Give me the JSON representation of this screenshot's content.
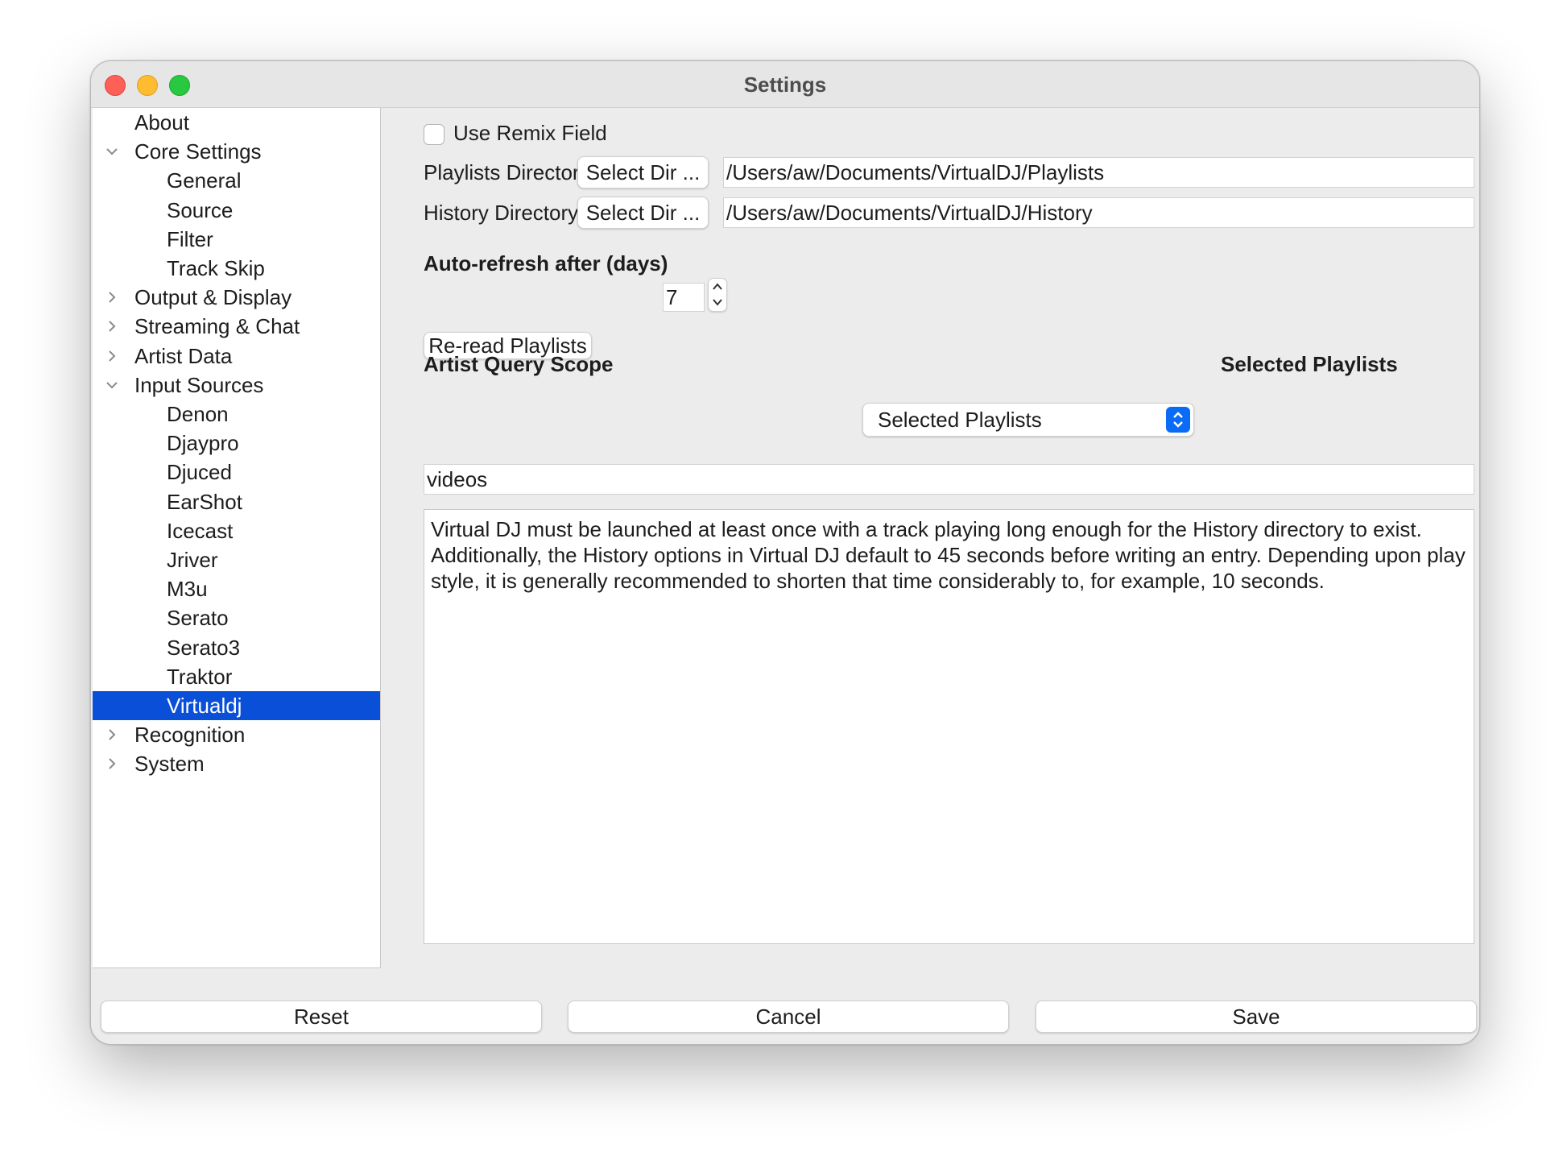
{
  "window": {
    "title": "Settings"
  },
  "sidebar": {
    "items": [
      {
        "label": "About",
        "level": 0,
        "arrow": ""
      },
      {
        "label": "Core Settings",
        "level": 0,
        "arrow": "expanded"
      },
      {
        "label": "General",
        "level": 1,
        "arrow": ""
      },
      {
        "label": "Source",
        "level": 1,
        "arrow": ""
      },
      {
        "label": "Filter",
        "level": 1,
        "arrow": ""
      },
      {
        "label": "Track Skip",
        "level": 1,
        "arrow": ""
      },
      {
        "label": "Output & Display",
        "level": 0,
        "arrow": "collapsed"
      },
      {
        "label": "Streaming & Chat",
        "level": 0,
        "arrow": "collapsed"
      },
      {
        "label": "Artist Data",
        "level": 0,
        "arrow": "collapsed"
      },
      {
        "label": "Input Sources",
        "level": 0,
        "arrow": "expanded"
      },
      {
        "label": "Denon",
        "level": 1,
        "arrow": ""
      },
      {
        "label": "Djaypro",
        "level": 1,
        "arrow": ""
      },
      {
        "label": "Djuced",
        "level": 1,
        "arrow": ""
      },
      {
        "label": "EarShot",
        "level": 1,
        "arrow": ""
      },
      {
        "label": "Icecast",
        "level": 1,
        "arrow": ""
      },
      {
        "label": "Jriver",
        "level": 1,
        "arrow": ""
      },
      {
        "label": "M3u",
        "level": 1,
        "arrow": ""
      },
      {
        "label": "Serato",
        "level": 1,
        "arrow": ""
      },
      {
        "label": "Serato3",
        "level": 1,
        "arrow": ""
      },
      {
        "label": "Traktor",
        "level": 1,
        "arrow": ""
      },
      {
        "label": "Virtualdj",
        "level": 1,
        "arrow": "",
        "selected": true
      },
      {
        "label": "Recognition",
        "level": 0,
        "arrow": "collapsed"
      },
      {
        "label": "System",
        "level": 0,
        "arrow": "collapsed"
      }
    ]
  },
  "content": {
    "use_remix_label": "Use Remix Field",
    "use_remix_checked": false,
    "playlists_dir_label": "Playlists Directory",
    "history_dir_label": "History Directory",
    "select_dir_label": "Select Dir ...",
    "playlists_dir_value": "/Users/aw/Documents/VirtualDJ/Playlists",
    "history_dir_value": "/Users/aw/Documents/VirtualDJ/History",
    "autorefresh_label": "Auto-refresh after (days)",
    "autorefresh_value": "7",
    "reread_label": "Re-read Playlists",
    "artist_query_label": "Artist Query Scope",
    "artist_query_selected": "Selected Playlists",
    "artist_query_side_label": "Selected Playlists",
    "playlist_filter_value": "videos",
    "description": "Virtual DJ must be launched at least once with a track playing long enough for the History directory to exist.  Additionally, the History options in Virtual DJ default to 45 seconds before writing an entry. Depending upon play style, it is generally recommended to shorten that time considerably to, for example, 10 seconds."
  },
  "footer": {
    "reset_label": "Reset",
    "cancel_label": "Cancel",
    "save_label": "Save"
  },
  "colors": {
    "selection": "#0a4fd8",
    "select_accent": "#0a6cf5",
    "close": "#fe5f57",
    "minimize": "#febc2e",
    "zoom": "#28c840"
  }
}
